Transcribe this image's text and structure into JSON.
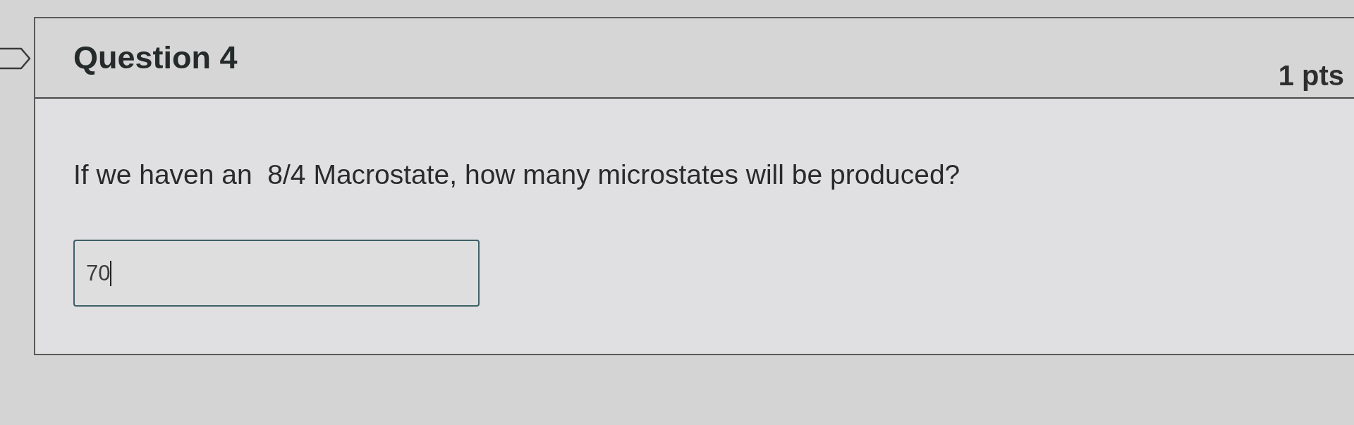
{
  "question": {
    "title": "Question 4",
    "points": "1 pts",
    "flagged": false,
    "text": "If we haven an  8/4 Macrostate, how many microstates will be produced?",
    "answer": {
      "value": "70",
      "focused": true
    }
  }
}
